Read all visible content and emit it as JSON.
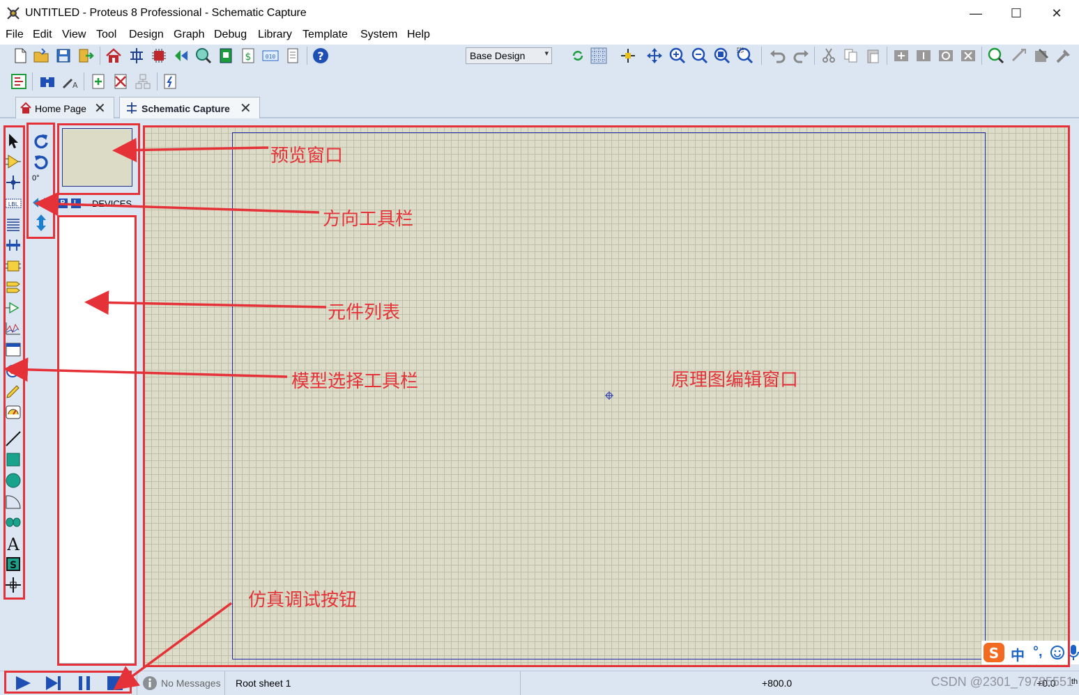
{
  "window": {
    "title": "UNTITLED - Proteus 8 Professional - Schematic Capture",
    "minimize": "—",
    "maximize": "☐",
    "close": "✕"
  },
  "menu": [
    "File",
    "Edit",
    "View",
    "Tool",
    "Design",
    "Graph",
    "Debug",
    "Library",
    "Template",
    "System",
    "Help"
  ],
  "toolbar": {
    "design_select": "Base Design"
  },
  "tabs": [
    {
      "label": "Home Page",
      "close": "✕"
    },
    {
      "label": "Schematic Capture",
      "close": "✕"
    }
  ],
  "orientation": {
    "angle": "0°"
  },
  "devices_panel": {
    "p_button": "P",
    "l_button": "L",
    "header": "DEVICES"
  },
  "status": {
    "messages": "No Messages",
    "sheet": "Root sheet 1",
    "coord_x": "+800.0",
    "coord_y": "+0.0",
    "unit": "th"
  },
  "ime": {
    "label_cn": "中",
    "punct": "°,"
  },
  "annotations": {
    "preview_window": "预览窗口",
    "orientation_toolbar": "方向工具栏",
    "component_list": "元件列表",
    "mode_toolbar": "模型选择工具栏",
    "schematic_window": "原理图编辑窗口",
    "simulation_buttons": "仿真调试按钮"
  },
  "watermark": "CSDN @2301_79785551",
  "colors": {
    "annotation_red": "#e53238",
    "canvas_bg": "#dcdcc8",
    "sheet_border": "#1a2aa6",
    "chrome_blue": "#dbe6f2"
  }
}
